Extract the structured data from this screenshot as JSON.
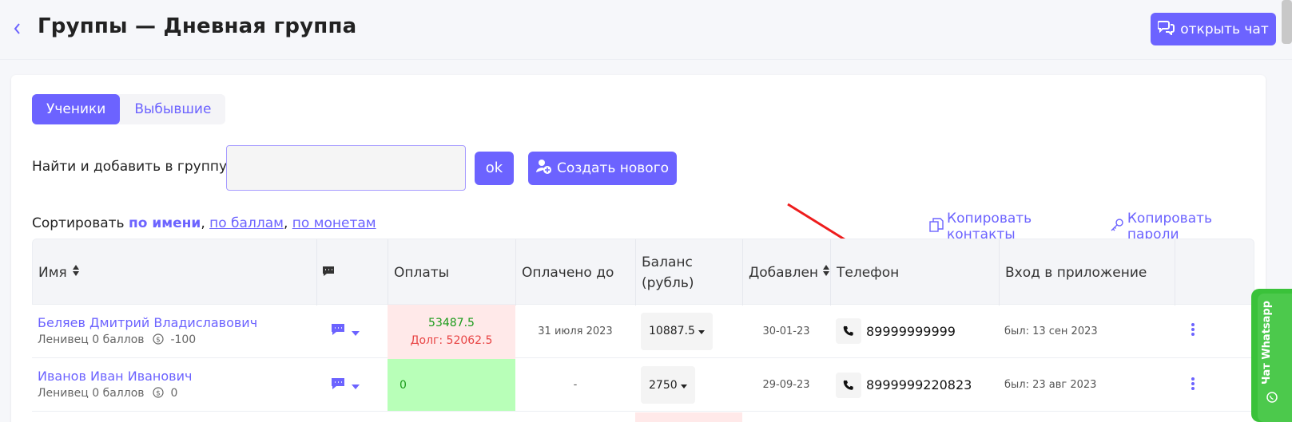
{
  "header": {
    "title": "Группы — Дневная группа",
    "chat_button": "открыть чат"
  },
  "tabs": [
    {
      "label": "Ученики",
      "active": true
    },
    {
      "label": "Выбывшие",
      "active": false
    }
  ],
  "search": {
    "label": "Найти и добавить в группу:",
    "value": "",
    "ok_label": "ok",
    "create_label": "Создать нового"
  },
  "sort": {
    "prefix": "Сортировать",
    "by_name": "по имени",
    "by_points": "по баллам",
    "by_coins": "по монетам",
    "sep": ","
  },
  "actions": {
    "copy_contacts": "Копировать контакты",
    "copy_passwords": "Копировать пароли"
  },
  "table": {
    "headers": {
      "name": "Имя",
      "payments": "Оплаты",
      "paid_until": "Оплачено до",
      "balance_l1": "Баланс",
      "balance_l2": "(рубль)",
      "added": "Добавлен",
      "phone": "Телефон",
      "app_login": "Вход в приложение"
    },
    "rows": [
      {
        "name": "Беляев Дмитрий Владиславович",
        "sub": "Ленивец 0 баллов",
        "coins": "-100",
        "payment": "53487.5",
        "debt": "Долг: 52062.5",
        "paid_until": "31 июля 2023",
        "balance": "10887.5",
        "added": "30-01-23",
        "phone": "89999999999",
        "seen": "был: 13 сен 2023"
      },
      {
        "name": "Иванов Иван Иванович",
        "sub": "Ленивец 0 баллов",
        "coins": "0",
        "payment": "0",
        "debt": "",
        "paid_until": "-",
        "balance": "2750",
        "added": "29-09-23",
        "phone": "8999999220823",
        "seen": "был: 23 авг 2023"
      }
    ]
  },
  "whatsapp": {
    "label": "Чат Whatsapp"
  },
  "colors": {
    "accent": "#6c63ff",
    "debt_bg": "#ffe9e9",
    "paid_bg": "#b8ffb8",
    "annotation_arrow": "#ee1c1c",
    "whatsapp": "#3ac23a"
  }
}
